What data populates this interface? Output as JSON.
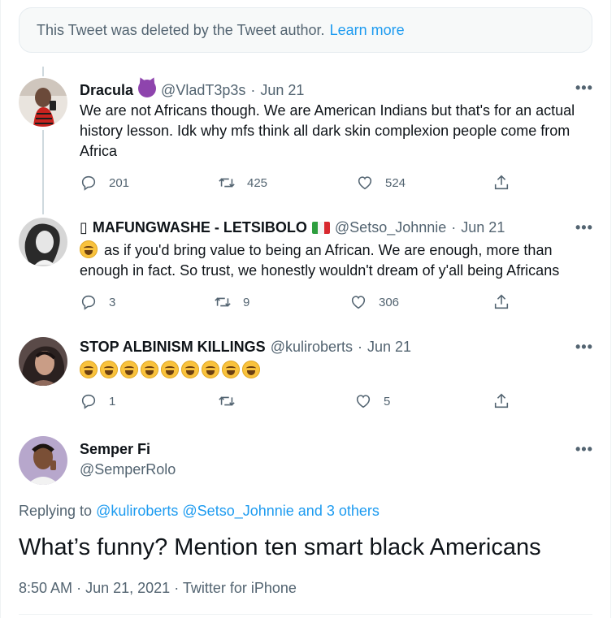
{
  "deleted_notice": {
    "text": "This Tweet was deleted by the Tweet author.",
    "link": "Learn more"
  },
  "tweets": [
    {
      "name": "Dracula",
      "handle": "@VladT3p3s",
      "sep": "·",
      "date": "Jun 21",
      "emoji": "smiling-imp-emoji",
      "text": "We are not Africans though. We are American Indians but that's for an actual history lesson. Idk why mfs think all dark skin complexion people come from Africa",
      "replies": "201",
      "retweets": "425",
      "likes": "524"
    },
    {
      "name": "MAFUNGWASHE - LETSIBOLO",
      "name_prefix": "▯",
      "flag": "italy-flag",
      "handle": "@Setso_Johnnie",
      "sep": "·",
      "date": "Jun 21",
      "text": "as if you'd bring value to being an African. We are enough, more than enough in fact. So trust, we honestly wouldn't dream of y'all being Africans",
      "replies": "3",
      "retweets": "9",
      "likes": "306"
    },
    {
      "name": "STOP ALBINISM KILLINGS",
      "handle": "@kuliroberts",
      "sep": "·",
      "date": "Jun 21",
      "laugh_count": 9,
      "replies": "1",
      "retweets": "",
      "likes": "5"
    }
  ],
  "main_tweet": {
    "name": "Semper Fi",
    "handle": "@SemperRolo",
    "replying_prefix": "Replying to",
    "mention1": "@kuliroberts",
    "mention2": "@Setso_Johnnie",
    "and_others": "and 3 others",
    "text": "What’s funny? Mention ten smart black Americans",
    "time": "8:50 AM",
    "sep": "·",
    "date": "Jun 21, 2021",
    "client": "Twitter for iPhone"
  },
  "icons": {
    "more": "•••",
    "reply": "reply-icon",
    "retweet": "retweet-icon",
    "like": "like-icon",
    "share": "share-icon"
  },
  "colors": {
    "accent": "#1d9bf0",
    "secondary": "#536471",
    "text": "#0f1419"
  }
}
